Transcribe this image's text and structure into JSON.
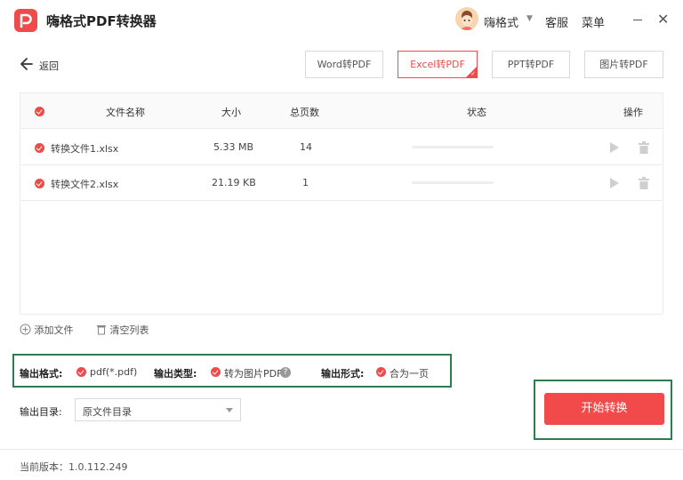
{
  "app": {
    "title": "嗨格式PDF转换器",
    "username": "嗨格式",
    "service": "客服",
    "menu": "菜单",
    "brand_color": "#ef4b4b"
  },
  "nav": {
    "back_label": "返回",
    "tabs": [
      {
        "label": "Word转PDF",
        "active": false
      },
      {
        "label": "Excel转PDF",
        "active": true
      },
      {
        "label": "PPT转PDF",
        "active": false
      },
      {
        "label": "图片转PDF",
        "active": false
      }
    ]
  },
  "table": {
    "headers": {
      "name": "文件名称",
      "size": "大小",
      "pages": "总页数",
      "status": "状态",
      "actions": "操作"
    },
    "rows": [
      {
        "name": "转换文件1.xlsx",
        "size": "5.33 MB",
        "pages": "14",
        "progress": 0
      },
      {
        "name": "转换文件2.xlsx",
        "size": "21.19 KB",
        "pages": "1",
        "progress": 0
      }
    ]
  },
  "file_actions": {
    "add": "添加文件",
    "clear": "清空列表"
  },
  "options": {
    "format_label": "输出格式:",
    "format_value": "pdf(*.pdf)",
    "type_label": "输出类型:",
    "type_value": "转为图片PDF",
    "form_label": "输出形式:",
    "form_value": "合为一页",
    "help_icon": "?"
  },
  "output_dir": {
    "label": "输出目录:",
    "value": "原文件目录"
  },
  "start_button": "开始转换",
  "footer": {
    "version": "当前版本：1.0.112.249"
  }
}
